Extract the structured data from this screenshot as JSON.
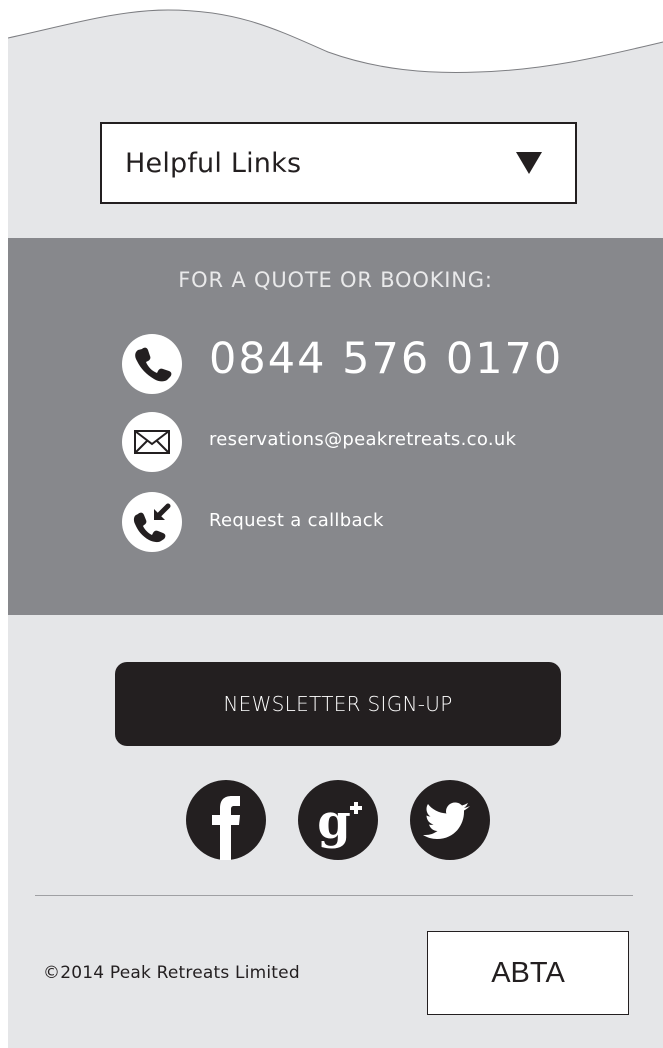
{
  "dropdown": {
    "label": "Helpful Links",
    "arrow_icon": "triangle-down-icon"
  },
  "contact": {
    "heading": "FOR A QUOTE OR BOOKING:",
    "phone": "0844 576 0170",
    "email": "reservations@peakretreats.co.uk",
    "callback": "Request a callback",
    "icons": [
      "phone-icon",
      "envelope-icon",
      "callback-icon"
    ]
  },
  "newsletter": {
    "label": "NEWSLETTER SIGN-UP"
  },
  "social": {
    "items": [
      "facebook-icon",
      "google-plus-icon",
      "twitter-icon"
    ],
    "gplus_glyph": "g+"
  },
  "footer": {
    "copyright": "©2014 Peak Retreats Limited",
    "badge": "ABTA"
  },
  "colors": {
    "background": "#e5e6e8",
    "contact_band": "#87888c",
    "dark": "#231f20",
    "light_text": "#ffffff"
  }
}
